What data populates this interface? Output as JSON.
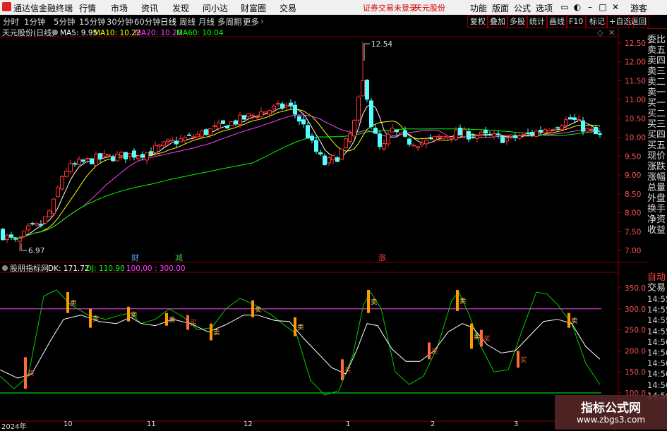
{
  "menubar": {
    "app_name": "通达信金融终端",
    "items": [
      "行情",
      "市场",
      "资讯",
      "发现",
      "问小达",
      "财富圈",
      "交易"
    ],
    "notice": "证券交易未登录",
    "stock": "天元股份",
    "right_items": [
      "功能",
      "版面",
      "公式",
      "选项"
    ],
    "guest": "游客"
  },
  "periodbar": {
    "periods": [
      "分时",
      "1分钟",
      "5分钟",
      "15分钟",
      "30分钟",
      "60分钟",
      "日线",
      "周线",
      "月线",
      "多周期",
      "更多"
    ],
    "active": "日线",
    "right_buttons": [
      "复权",
      "叠加",
      "多股",
      "统计",
      "画线",
      "F10",
      "标记",
      "+自选",
      "返回"
    ]
  },
  "main_chart": {
    "title": "天元股份(日线)",
    "ma_labels": [
      {
        "text": "MA5: 9.95",
        "color": "#ffffff"
      },
      {
        "text": "MA10: 10.22",
        "color": "#ffff00"
      },
      {
        "text": "MA20: 10.20",
        "color": "#ff40ff"
      },
      {
        "text": "MA60: 10.04",
        "color": "#00ff00"
      }
    ],
    "price_ticks": [
      "12.50",
      "12.00",
      "11.50",
      "11.00",
      "10.50",
      "10.00",
      "9.50",
      "9.00",
      "8.50",
      "8.00",
      "7.50",
      "7.00"
    ],
    "high_label": "12.54",
    "low_label": "6.97",
    "markers": [
      {
        "text": "财",
        "color": "#5aa0ff"
      },
      {
        "text": "减",
        "color": "#40c040"
      },
      {
        "text": "涨",
        "color": "#ff4040"
      }
    ]
  },
  "sub_chart": {
    "title": "股朋指标网",
    "dk_label": "DK: 171.72",
    "dj_label": "DJ: 110.90",
    "lines_label": ": 100.00 : 300.00",
    "ticks": [
      "350.0",
      "300.0",
      "250.0",
      "200.0",
      "150.0",
      "100.0"
    ],
    "signals": [
      {
        "text": "买",
        "kind": "buy"
      },
      {
        "text": "卖",
        "kind": "sell"
      },
      {
        "text": "卖",
        "kind": "sell"
      },
      {
        "text": "卖",
        "kind": "sell"
      },
      {
        "text": "卖",
        "kind": "sell"
      },
      {
        "text": "买",
        "kind": "buy"
      },
      {
        "text": "卖",
        "kind": "sell"
      },
      {
        "text": "卖",
        "kind": "sell"
      },
      {
        "text": "卖",
        "kind": "sell"
      },
      {
        "text": "买",
        "kind": "buy"
      },
      {
        "text": "卖",
        "kind": "sell"
      },
      {
        "text": "买",
        "kind": "buy"
      },
      {
        "text": "卖",
        "kind": "sell"
      },
      {
        "text": "卖",
        "kind": "sell"
      },
      {
        "text": "买",
        "kind": "buy"
      },
      {
        "text": "买",
        "kind": "buy"
      },
      {
        "text": "卖",
        "kind": "sell"
      }
    ]
  },
  "time_axis": [
    "2024年",
    "10",
    "11",
    "12",
    "1",
    "2",
    "3"
  ],
  "side_panel": {
    "items": [
      "委比",
      "卖五",
      "卖四",
      "卖三",
      "卖二",
      "卖一",
      "买一",
      "买二",
      "买三",
      "买四",
      "买五",
      "现价",
      "涨跌",
      "涨幅",
      "总量",
      "外盘",
      "换手",
      "净资",
      "收益"
    ],
    "lower_items": [
      "自动",
      "交易"
    ],
    "times": [
      "14:55",
      "14:55",
      "14:55",
      "14:55",
      "14:56",
      "14:56",
      "14:56",
      "14:56",
      "14:56",
      "14:56"
    ]
  },
  "watermark": {
    "title": "指标公式网",
    "url": "www.zbgs3.com"
  },
  "colors": {
    "up": "#ff3232",
    "down": "#54ffff",
    "ma5": "#ffffff",
    "ma10": "#ffff00",
    "ma20": "#ff40ff",
    "ma60": "#00ff00",
    "frame": "#800000",
    "signal": "#ff9900"
  }
}
